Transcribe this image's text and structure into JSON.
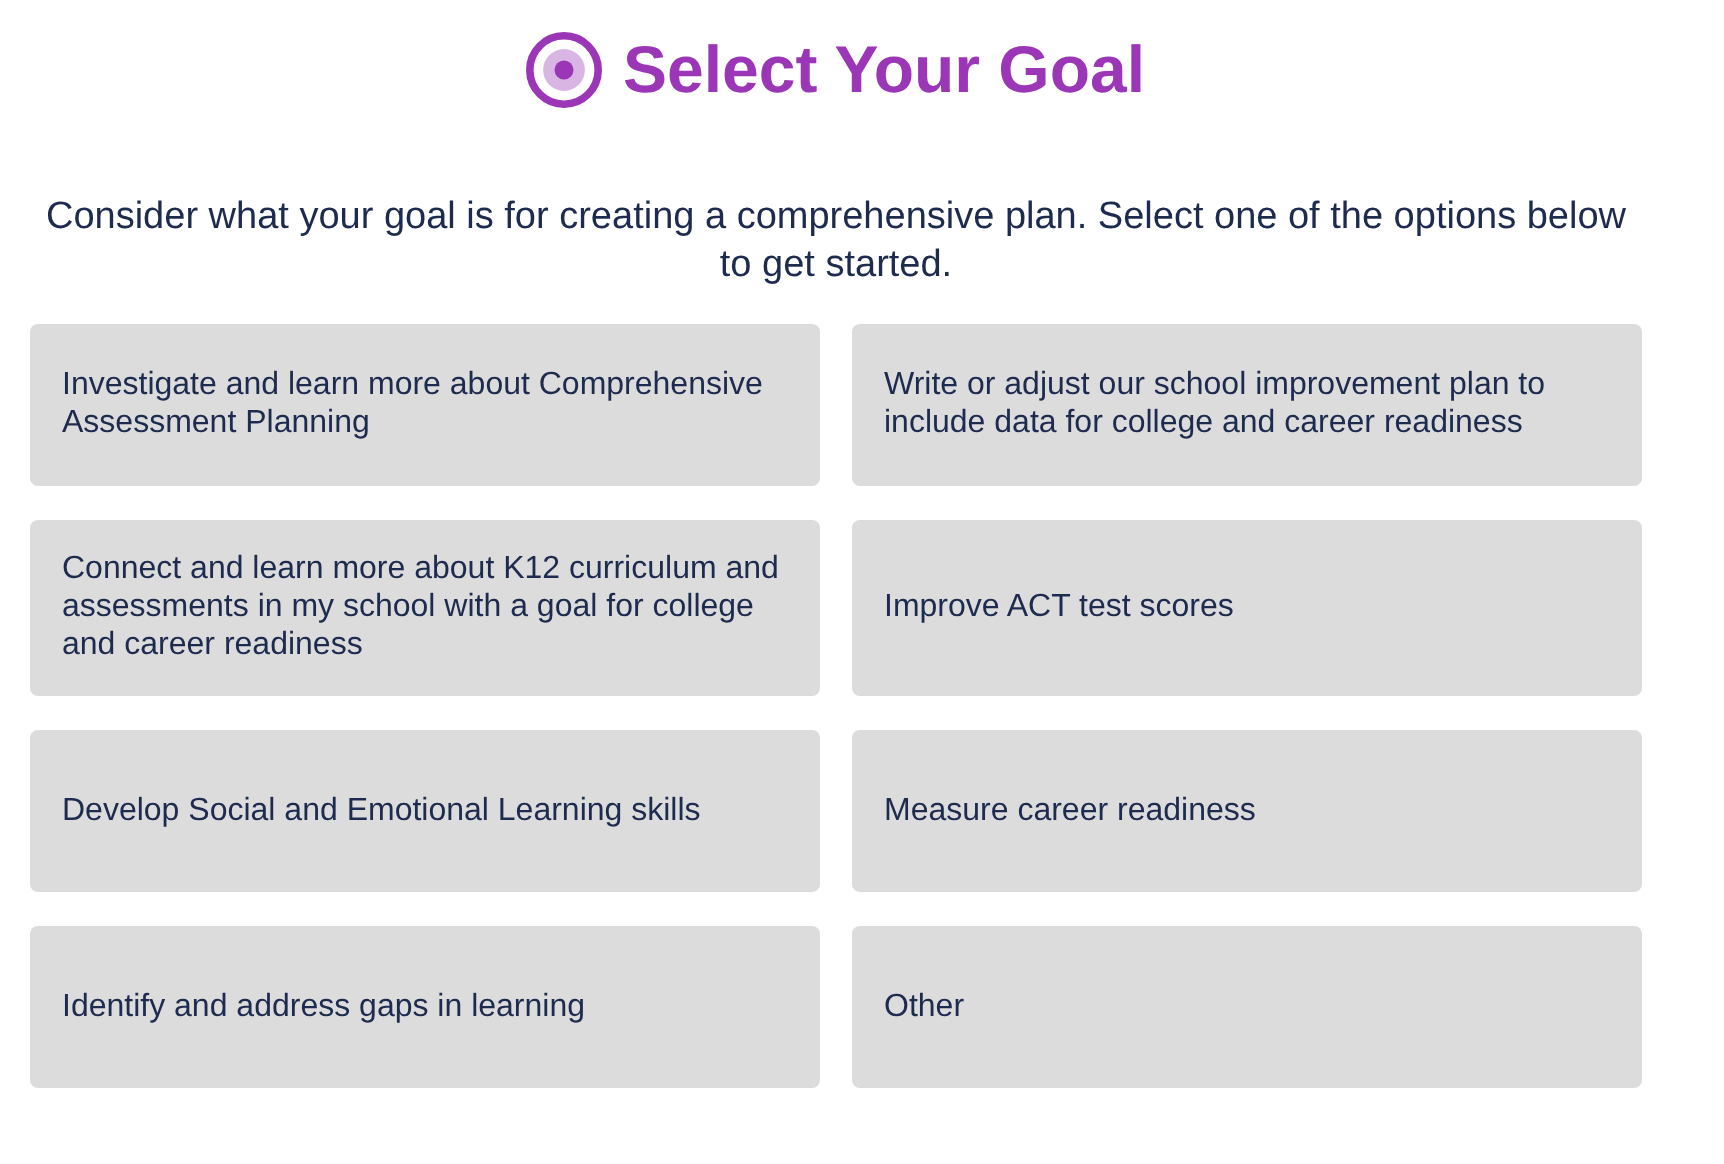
{
  "header": {
    "title": "Select Your Goal"
  },
  "intro": "Consider what your goal is for creating a comprehensive plan. Select one of the options below to get started.",
  "options": [
    {
      "label": "Investigate and learn more about Comprehensive Assessment Planning"
    },
    {
      "label": "Write or adjust our school improvement plan to include data for college and career readiness"
    },
    {
      "label": "Connect and learn more about K12 curriculum and assessments in my school with a goal for college and career readiness"
    },
    {
      "label": "Improve ACT test scores"
    },
    {
      "label": "Develop Social and Emotional Learning skills"
    },
    {
      "label": "Measure career readiness"
    },
    {
      "label": "Identify and address gaps in learning"
    },
    {
      "label": "Other"
    }
  ]
}
